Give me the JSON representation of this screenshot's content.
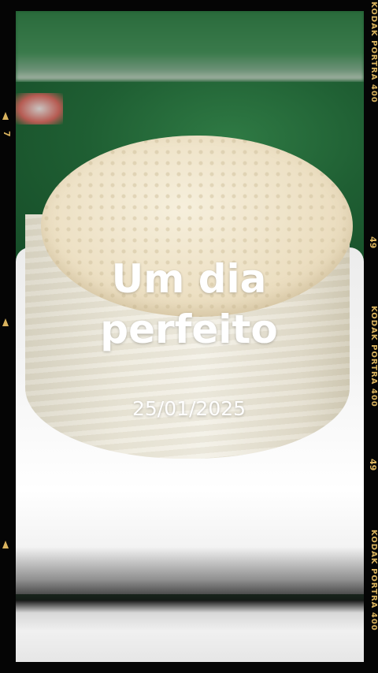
{
  "overlay": {
    "title_line1": "Um dia",
    "title_line2": "perfeito",
    "date": "25/01/2025"
  },
  "film_strip": {
    "label": "KODAK PORTRA 400",
    "frame_number": "49",
    "left_number": "7",
    "accent_color": "#d9b35e"
  }
}
